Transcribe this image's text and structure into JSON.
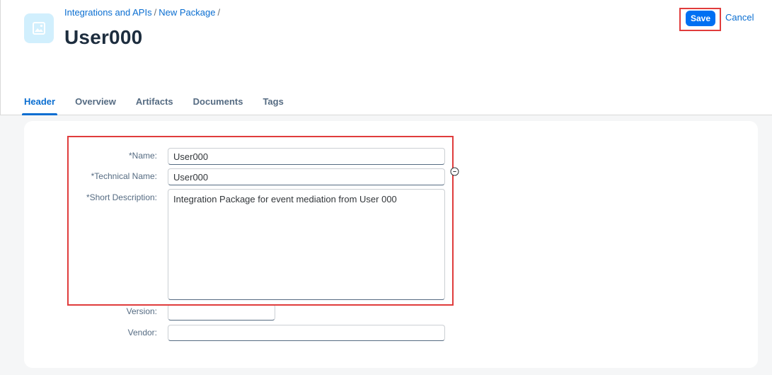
{
  "breadcrumb": {
    "items": [
      "Integrations and APIs",
      "New Package"
    ],
    "separator": "/"
  },
  "page": {
    "title": "User000"
  },
  "actions": {
    "save_label": "Save",
    "cancel_label": "Cancel"
  },
  "tabs": [
    {
      "label": "Header",
      "active": true
    },
    {
      "label": "Overview"
    },
    {
      "label": "Artifacts"
    },
    {
      "label": "Documents"
    },
    {
      "label": "Tags"
    }
  ],
  "form": {
    "name": {
      "label": "*Name:",
      "value": "User000"
    },
    "technical_name": {
      "label": "*Technical Name:",
      "value": "User000"
    },
    "short_description": {
      "label": "*Short Description:",
      "value": "Integration Package for event mediation from User 000"
    },
    "version": {
      "label": "Version:",
      "value": ""
    },
    "vendor": {
      "label": "Vendor:",
      "value": ""
    }
  },
  "colors": {
    "accent": "#0a6ed1",
    "save_button": "#0070f2",
    "highlight": "#e03c3c",
    "avatar_bg": "#d1effd"
  },
  "icons": {
    "avatar": "image-placeholder-icon",
    "field_action": "clear-circle-icon"
  }
}
